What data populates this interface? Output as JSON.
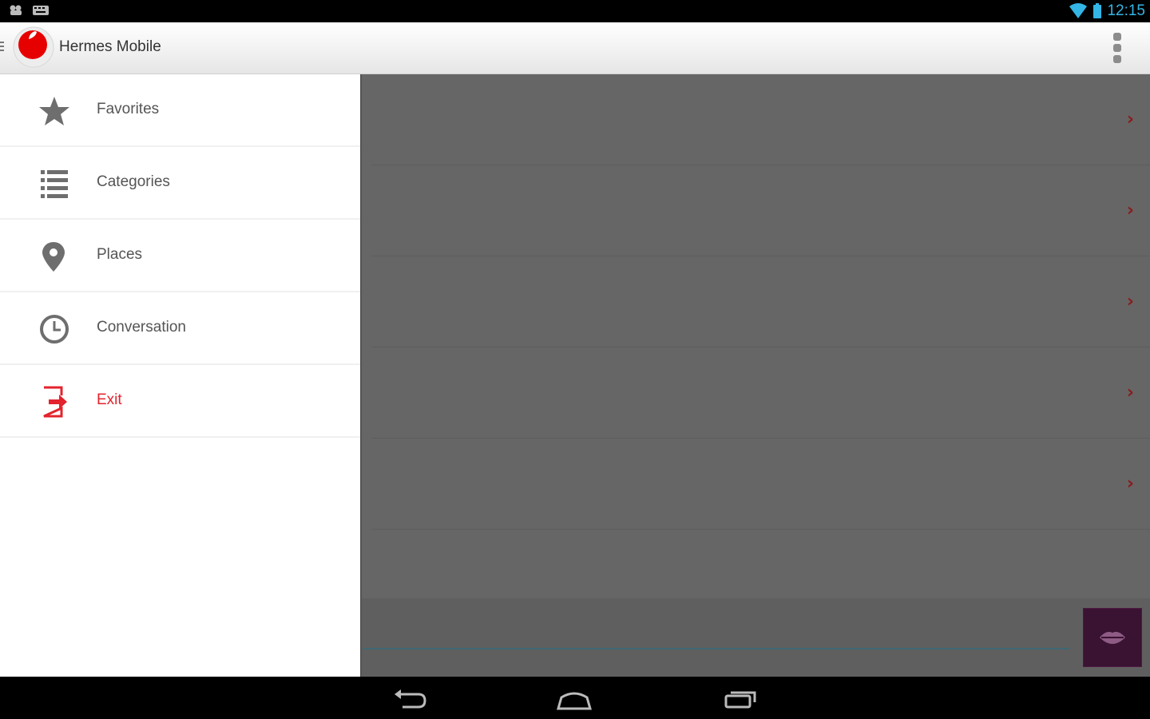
{
  "status_bar": {
    "time": "12:15",
    "left_icons": [
      "usb-debug-icon",
      "keyboard-icon"
    ],
    "right_icons": [
      "wifi-icon",
      "battery-icon"
    ]
  },
  "action_bar": {
    "title": "Hermes Mobile",
    "logo": "vodafone-logo",
    "overflow_icon": "overflow-menu-icon"
  },
  "drawer": {
    "items": [
      {
        "label": "Favorites",
        "icon": "star-icon"
      },
      {
        "label": "Categories",
        "icon": "list-icon"
      },
      {
        "label": "Places",
        "icon": "location-pin-icon"
      },
      {
        "label": "Conversation",
        "icon": "clock-icon"
      },
      {
        "label": "Exit",
        "icon": "exit-icon"
      }
    ]
  },
  "colors": {
    "accent_red": "#e3232d",
    "status_time": "#33b5e5",
    "send_button": "#3a1232",
    "overlay": "#666666"
  },
  "content": {
    "rows": 6,
    "row_icon": "chevron-right-icon",
    "send_icon": "lips-icon"
  },
  "nav_bar": {
    "buttons": [
      "back-icon",
      "home-icon",
      "recents-icon"
    ]
  }
}
